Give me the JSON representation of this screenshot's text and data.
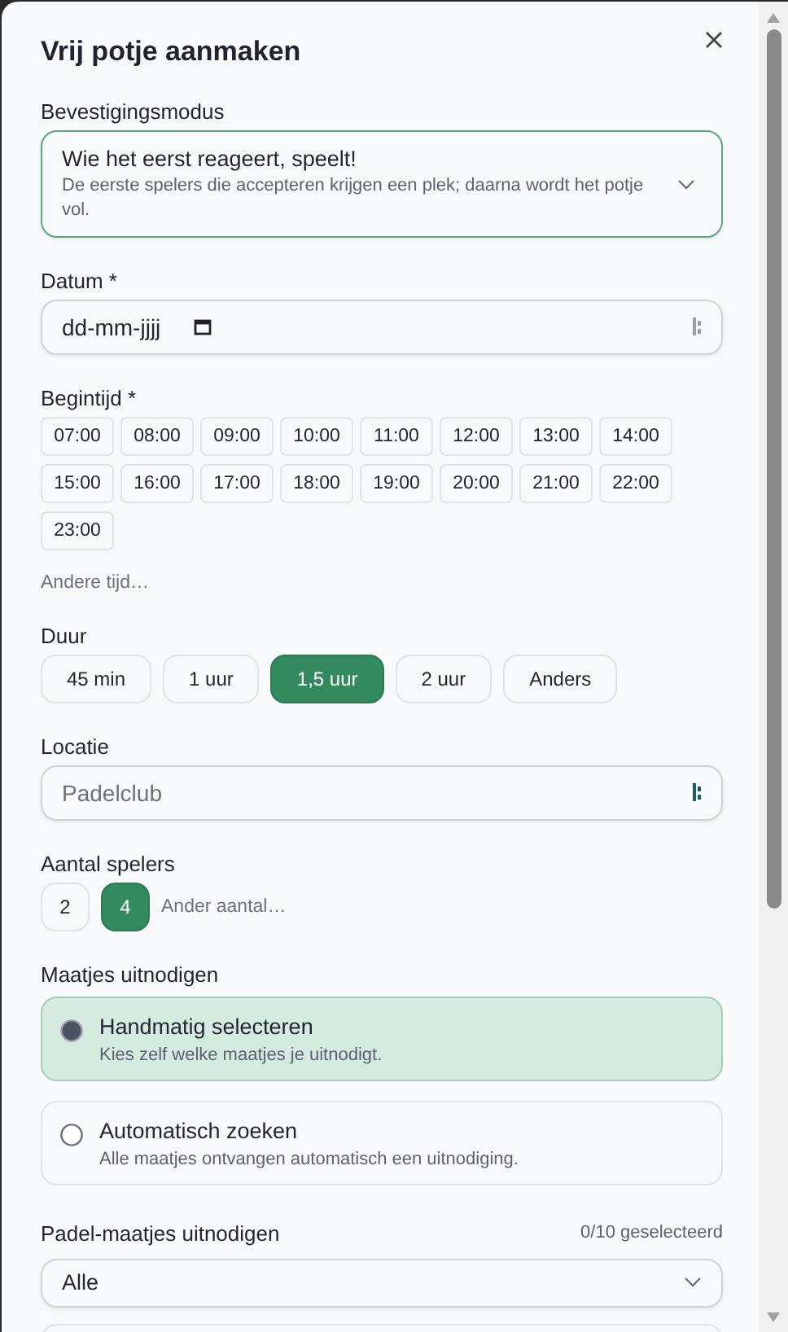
{
  "dialog": {
    "title": "Vrij potje aanmaken"
  },
  "confirmation": {
    "label": "Bevestigingsmodus",
    "value": "Wie het eerst reageert, speelt!",
    "description": "De eerste spelers die accepteren krijgen een plek; daarna wordt het potje vol."
  },
  "date": {
    "label": "Datum *",
    "value": "dd-mm-jjjj"
  },
  "start_time": {
    "label": "Begintijd *",
    "options": [
      {
        "label": "07:00",
        "selected": false
      },
      {
        "label": "08:00",
        "selected": false
      },
      {
        "label": "09:00",
        "selected": false
      },
      {
        "label": "10:00",
        "selected": false
      },
      {
        "label": "11:00",
        "selected": false
      },
      {
        "label": "12:00",
        "selected": false
      },
      {
        "label": "13:00",
        "selected": false
      },
      {
        "label": "14:00",
        "selected": false
      },
      {
        "label": "15:00",
        "selected": false
      },
      {
        "label": "16:00",
        "selected": false
      },
      {
        "label": "17:00",
        "selected": false
      },
      {
        "label": "18:00",
        "selected": false
      },
      {
        "label": "19:00",
        "selected": false
      },
      {
        "label": "20:00",
        "selected": false
      },
      {
        "label": "21:00",
        "selected": false
      },
      {
        "label": "22:00",
        "selected": false
      },
      {
        "label": "23:00",
        "selected": false
      }
    ],
    "other_link": "Andere tijd…"
  },
  "duration": {
    "label": "Duur",
    "options": [
      {
        "label": "45 min",
        "selected": false
      },
      {
        "label": "1 uur",
        "selected": false
      },
      {
        "label": "1,5 uur",
        "selected": true
      },
      {
        "label": "2 uur",
        "selected": false
      },
      {
        "label": "Anders",
        "selected": false
      }
    ]
  },
  "location": {
    "label": "Locatie",
    "placeholder": "Padelclub"
  },
  "players": {
    "label": "Aantal spelers",
    "options": [
      {
        "label": "2",
        "selected": false
      },
      {
        "label": "4",
        "selected": true
      }
    ],
    "other_link": "Ander aantal…"
  },
  "invite": {
    "label": "Maatjes uitnodigen",
    "options": [
      {
        "title": "Handmatig selecteren",
        "description": "Kies zelf welke maatjes je uitnodigt.",
        "selected": true
      },
      {
        "title": "Automatisch zoeken",
        "description": "Alle maatjes ontvangen automatisch een uitnodiging.",
        "selected": false
      }
    ]
  },
  "buddies": {
    "label": "Padel-maatjes uitnodigen",
    "count": "0/10 geselecteerd",
    "filter": "Alle"
  }
}
